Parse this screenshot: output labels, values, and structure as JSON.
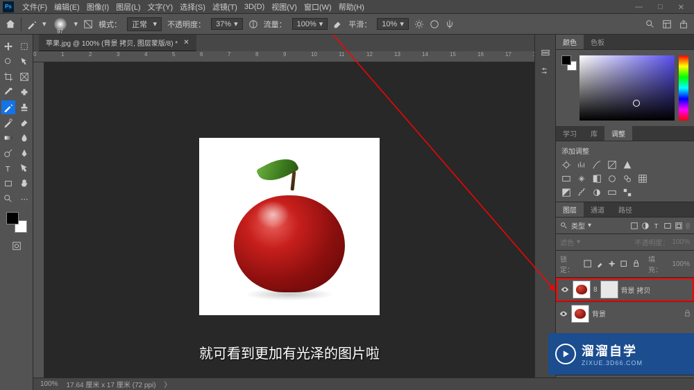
{
  "menu": {
    "file": "文件(F)",
    "edit": "编辑(E)",
    "image": "图像(I)",
    "layer": "图层(L)",
    "text": "文字(Y)",
    "select": "选择(S)",
    "filter": "滤镜(T)",
    "three": "3D(D)",
    "view": "视图(V)",
    "window": "窗口(W)",
    "help": "帮助(H)"
  },
  "optbar": {
    "brush_size": "97",
    "mode_label": "模式：",
    "mode_value": "正常",
    "opacity_label": "不透明度：",
    "opacity_value": "37%",
    "flow_label": "流量：",
    "flow_value": "100%",
    "smooth_label": "平滑：",
    "smooth_value": "10%"
  },
  "doc_tab": "苹果.jpg @ 100% (背景 拷贝, 图层蒙版/8) *",
  "subtitle": "就可看到更加有光泽的图片啦",
  "status": {
    "zoom": "100%",
    "info": "17.64 厘米 x 17 厘米 (72 ppi)"
  },
  "panels": {
    "color_tab": "颜色",
    "swatch_tab": "色板",
    "learn_tab": "学习",
    "library_tab": "库",
    "adjust_tab": "调整",
    "add_adjust": "添加调整",
    "layers_tab": "图层",
    "channels_tab": "通道",
    "paths_tab": "路径"
  },
  "layer_filter": {
    "kind": "类型"
  },
  "layer_blend": {
    "mode": "滤色",
    "opacity_label": "不透明度：",
    "opacity": "100%"
  },
  "layer_lock": {
    "label": "锁定：",
    "fill_label": "填充：",
    "fill": "100%"
  },
  "layers": [
    {
      "name": "背景 拷贝",
      "selected": true
    },
    {
      "name": "背景",
      "locked": true
    }
  ],
  "watermark": {
    "brand": "溜溜自学",
    "url": "ZIXUE.3D66.COM"
  }
}
